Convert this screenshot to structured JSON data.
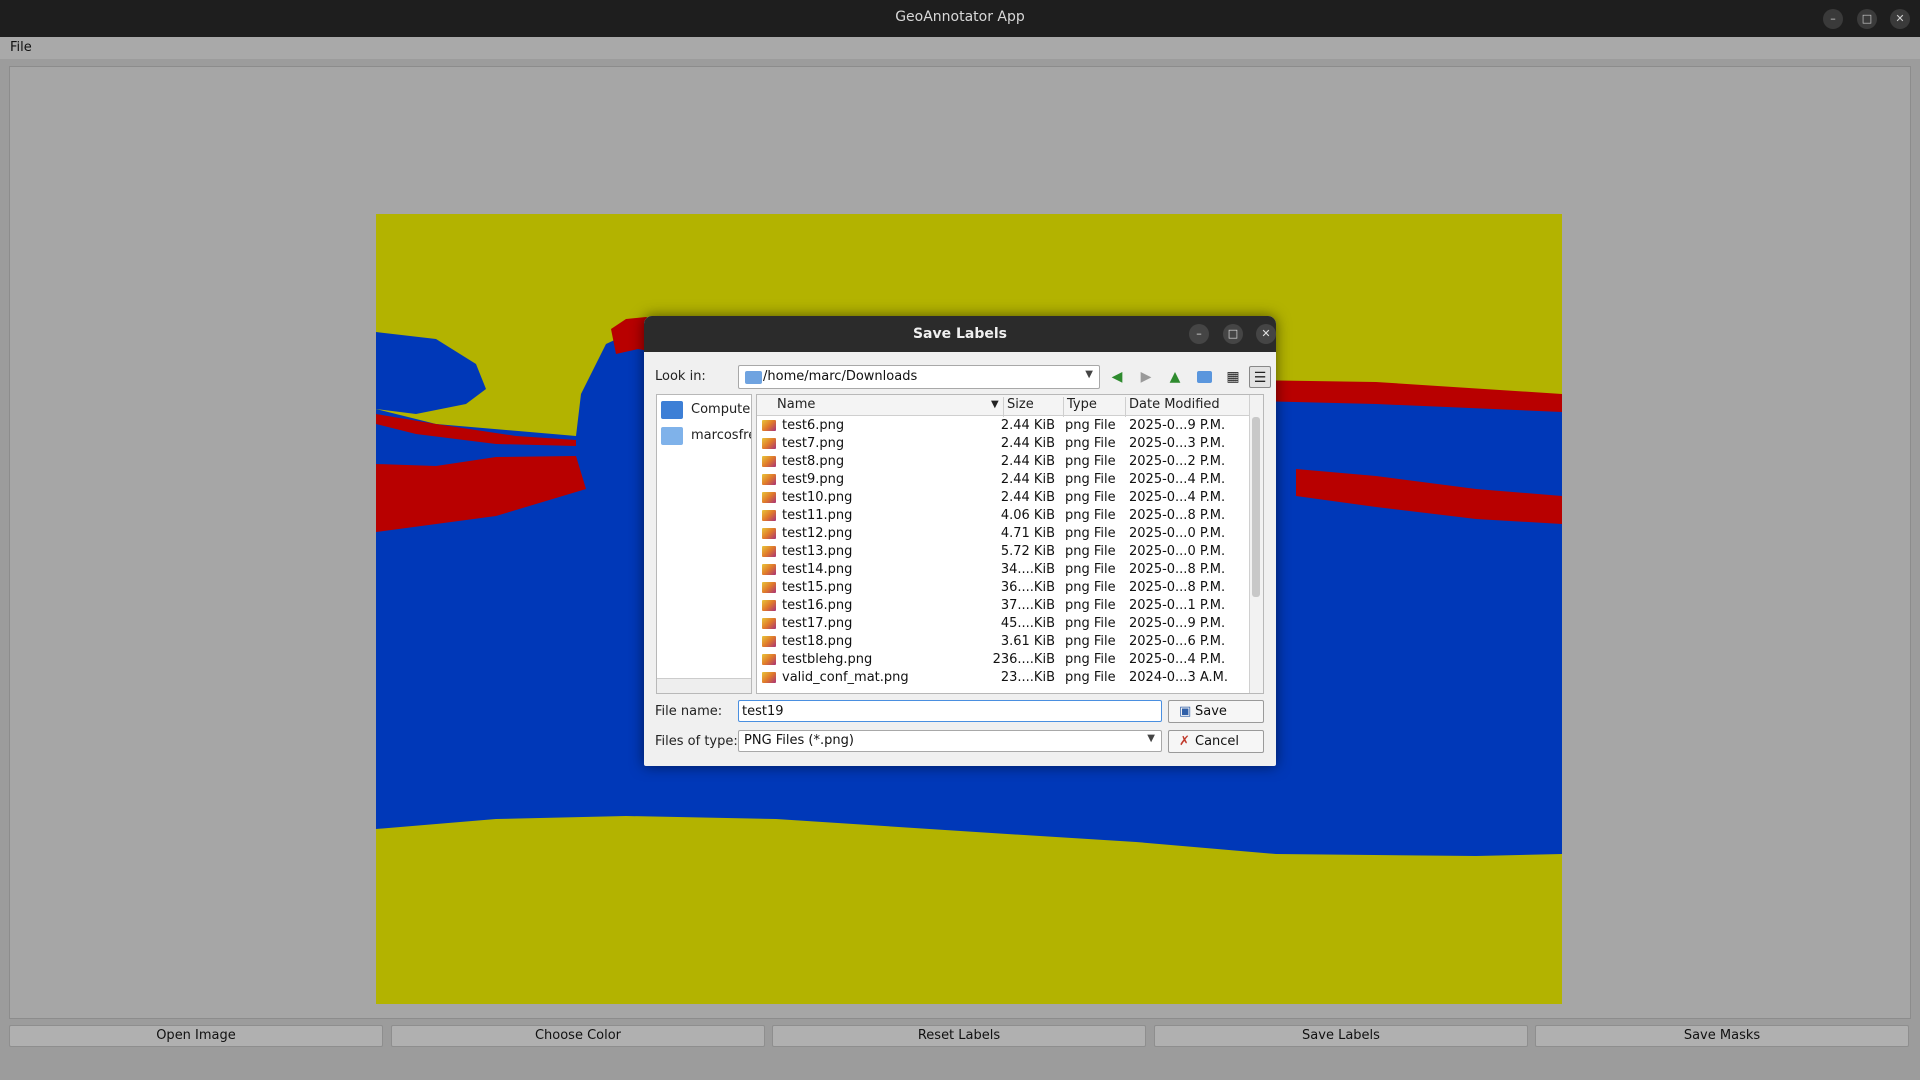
{
  "window": {
    "title": "GeoAnnotator App"
  },
  "menubar": {
    "file": "File"
  },
  "buttons": {
    "open_image": "Open Image",
    "choose_color": "Choose Color",
    "reset_labels": "Reset Labels",
    "save_labels": "Save Labels",
    "save_masks": "Save Masks"
  },
  "colors": {
    "yellow": "#b3b300",
    "blue": "#0038b8",
    "red": "#b80000"
  },
  "dialog": {
    "title": "Save Labels",
    "look_in_label": "Look in:",
    "look_in_path": "/home/marc/Downloads",
    "sidebar": [
      {
        "label": "Computer",
        "icon": "computer-icon"
      },
      {
        "label": "marcosfrei",
        "icon": "folder-icon"
      }
    ],
    "columns": {
      "name": "Name",
      "size": "Size",
      "type": "Type",
      "date": "Date Modified"
    },
    "files": [
      {
        "name": "test6.png",
        "size": "2.44 KiB",
        "type": "png File",
        "date": "2025-0...9 P.M."
      },
      {
        "name": "test7.png",
        "size": "2.44 KiB",
        "type": "png File",
        "date": "2025-0...3 P.M."
      },
      {
        "name": "test8.png",
        "size": "2.44 KiB",
        "type": "png File",
        "date": "2025-0...2 P.M."
      },
      {
        "name": "test9.png",
        "size": "2.44 KiB",
        "type": "png File",
        "date": "2025-0...4 P.M."
      },
      {
        "name": "test10.png",
        "size": "2.44 KiB",
        "type": "png File",
        "date": "2025-0...4 P.M."
      },
      {
        "name": "test11.png",
        "size": "4.06 KiB",
        "type": "png File",
        "date": "2025-0...8 P.M."
      },
      {
        "name": "test12.png",
        "size": "4.71 KiB",
        "type": "png File",
        "date": "2025-0...0 P.M."
      },
      {
        "name": "test13.png",
        "size": "5.72 KiB",
        "type": "png File",
        "date": "2025-0...0 P.M."
      },
      {
        "name": "test14.png",
        "size": "34....KiB",
        "type": "png File",
        "date": "2025-0...8 P.M."
      },
      {
        "name": "test15.png",
        "size": "36....KiB",
        "type": "png File",
        "date": "2025-0...8 P.M."
      },
      {
        "name": "test16.png",
        "size": "37....KiB",
        "type": "png File",
        "date": "2025-0...1 P.M."
      },
      {
        "name": "test17.png",
        "size": "45....KiB",
        "type": "png File",
        "date": "2025-0...9 P.M."
      },
      {
        "name": "test18.png",
        "size": "3.61 KiB",
        "type": "png File",
        "date": "2025-0...6 P.M."
      },
      {
        "name": "testblehg.png",
        "size": "236....KiB",
        "type": "png File",
        "date": "2025-0...4 P.M."
      },
      {
        "name": "valid_conf_mat.png",
        "size": "23....KiB",
        "type": "png File",
        "date": "2024-0...3 A.M."
      }
    ],
    "file_name_label": "File name:",
    "file_name_value": "test19",
    "files_of_type_label": "Files of type:",
    "files_of_type_value": "PNG Files (*.png)",
    "save_button": "Save",
    "cancel_button": "Cancel"
  }
}
